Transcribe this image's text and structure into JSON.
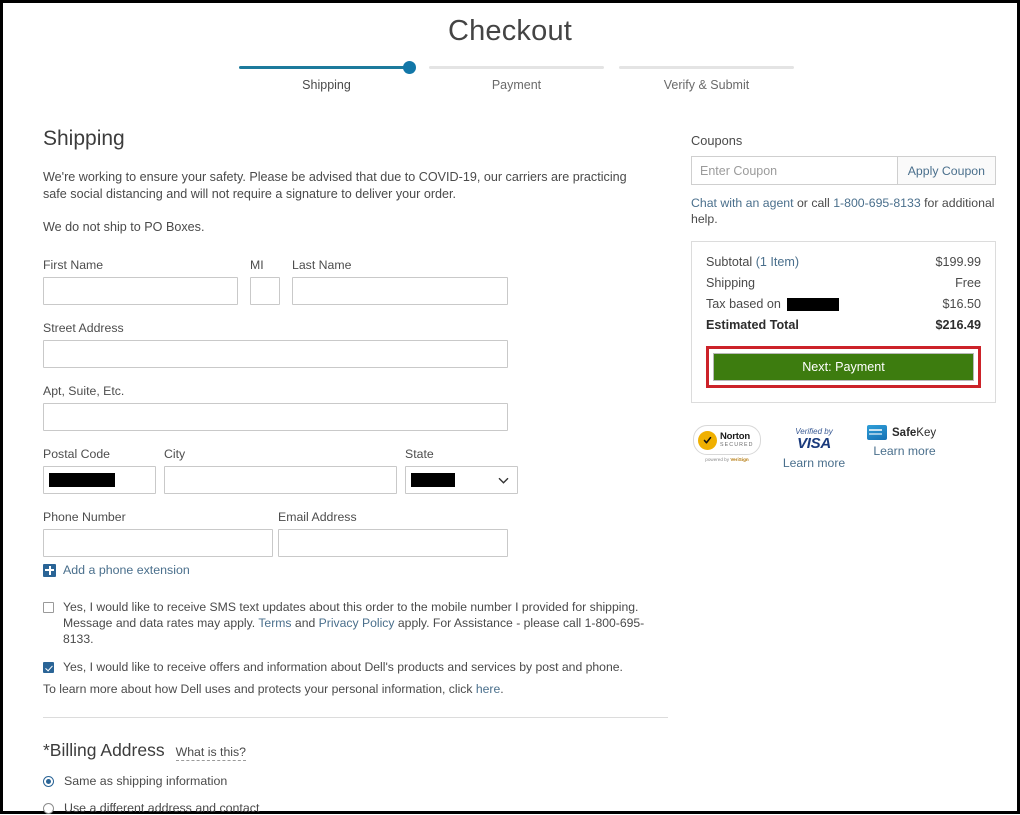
{
  "header": {
    "title": "Checkout",
    "steps": [
      {
        "label": "Shipping",
        "state": "active"
      },
      {
        "label": "Payment",
        "state": "inactive"
      },
      {
        "label": "Verify & Submit",
        "state": "inactive"
      }
    ]
  },
  "shipping": {
    "section_title": "Shipping",
    "covid_notice": "We're working to ensure your safety. Please be advised that due to COVID-19, our carriers are practicing safe social distancing and will not require a signature to deliver your order.",
    "po_box_notice": "We do not ship to PO Boxes.",
    "fields": {
      "first_name_label": "First Name",
      "first_name_value": "",
      "mi_label": "MI",
      "mi_value": "",
      "last_name_label": "Last Name",
      "last_name_value": "",
      "street_label": "Street Address",
      "street_value": "",
      "apt_label": "Apt, Suite, Etc.",
      "apt_value": "",
      "postal_label": "Postal Code",
      "postal_value": "[redacted]",
      "city_label": "City",
      "city_value": "",
      "state_label": "State",
      "state_value": "[redacted]",
      "phone_label": "Phone Number",
      "phone_value": "",
      "email_label": "Email Address",
      "email_value": ""
    },
    "add_extension_label": "Add a phone extension",
    "add_extension_icon": "plus-icon",
    "sms_optin": {
      "checked": false,
      "line1": "Yes, I would like to receive SMS text updates about this order to the mobile number I provided for shipping.",
      "line2_pre": "Message and data rates may apply. ",
      "terms_link": "Terms",
      "line2_mid": " and ",
      "privacy_link": "Privacy Policy",
      "line2_post": " apply. For Assistance - please call 1-800-695-8133."
    },
    "marketing_optin": {
      "checked": true,
      "text": "Yes, I would like to receive offers and information about Dell's products and services by post and phone."
    },
    "privacy_note_pre": "To learn more about how Dell uses and protects your personal information, click ",
    "privacy_note_link": "here",
    "privacy_note_post": "."
  },
  "billing": {
    "title": "*Billing Address",
    "what_is_this": "What is this?",
    "options": [
      {
        "label": "Same as shipping information",
        "selected": true
      },
      {
        "label": "Use a different address and contact",
        "selected": false
      }
    ]
  },
  "coupons": {
    "label": "Coupons",
    "input_placeholder": "Enter Coupon",
    "input_value": "",
    "apply_label": "Apply Coupon",
    "help_chat_link": "Chat with an agent",
    "help_mid": " or call ",
    "help_phone": "1-800-695-8133",
    "help_post": " for additional help."
  },
  "summary": {
    "subtotal_label": "Subtotal",
    "subtotal_items_link": "(1 Item)",
    "subtotal_value": "$199.99",
    "shipping_label": "Shipping",
    "shipping_value": "Free",
    "tax_label": "Tax based on",
    "tax_location": "[redacted]",
    "tax_value": "$16.50",
    "total_label": "Estimated Total",
    "total_value": "$216.49",
    "next_button_label": "Next: Payment"
  },
  "badges": {
    "norton_name": "Norton",
    "norton_secured": "SECURED",
    "norton_powered_pre": "powered by ",
    "norton_powered_brand": "VeriSign",
    "visa_verified": "Verified",
    "visa_by": " by",
    "visa_brand": "VISA",
    "visa_learn_more": "Learn more",
    "safekey_brand": "Safe",
    "safekey_brand2": "Key",
    "safekey_learn_more": "Learn more"
  },
  "colors": {
    "accent_blue": "#1c7a9c",
    "link_blue": "#4a6f8c",
    "button_green": "#3d7c0f",
    "highlight_red": "#cc2229",
    "norton_gold": "#f0b000"
  }
}
